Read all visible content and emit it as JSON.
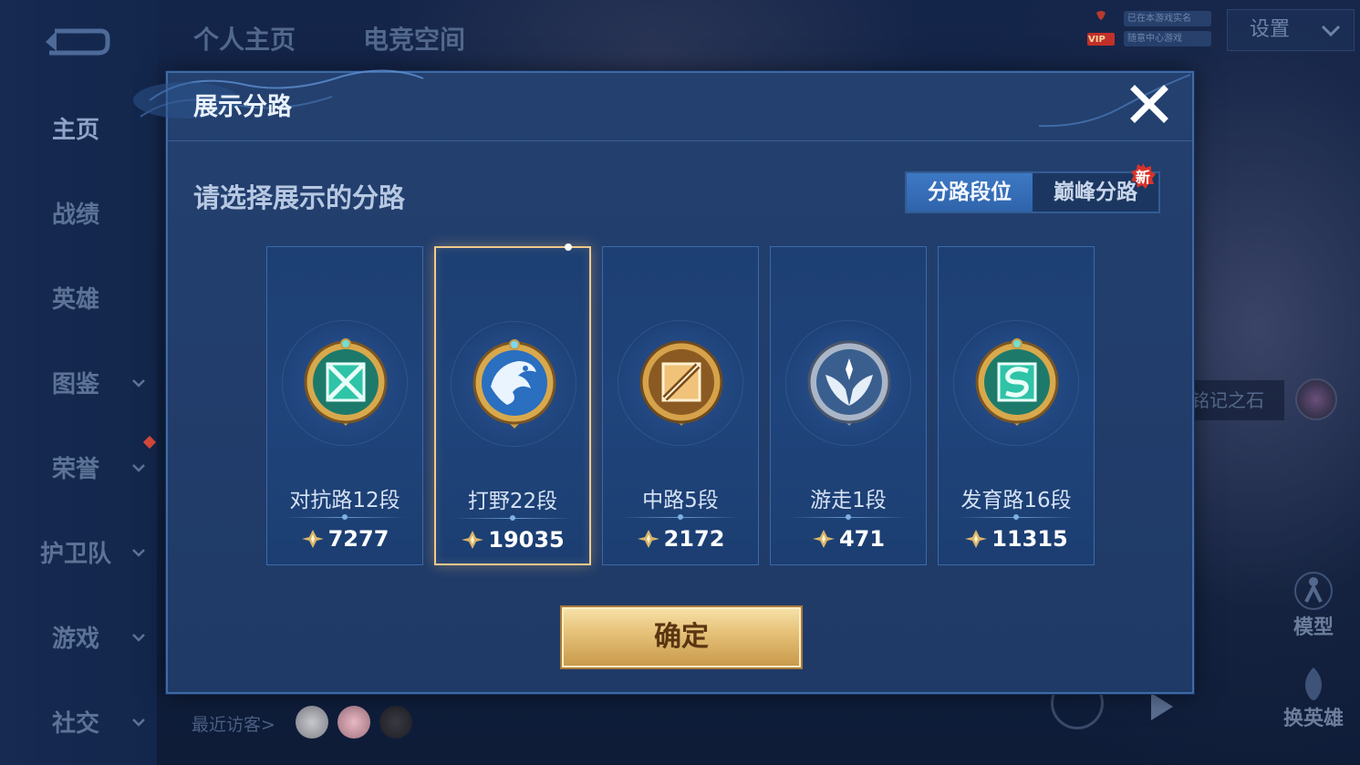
{
  "sidebar": {
    "back_icon": "back-arrow-icon",
    "items": [
      {
        "label": "主页",
        "active": true,
        "has_chevron": false
      },
      {
        "label": "战绩",
        "active": false,
        "has_chevron": false
      },
      {
        "label": "英雄",
        "active": false,
        "has_chevron": false
      },
      {
        "label": "图鉴",
        "active": false,
        "has_chevron": true
      },
      {
        "label": "荣誉",
        "active": false,
        "has_chevron": true
      },
      {
        "label": "护卫队",
        "active": false,
        "has_chevron": true
      },
      {
        "label": "游戏",
        "active": false,
        "has_chevron": true
      },
      {
        "label": "社交",
        "active": false,
        "has_chevron": true
      }
    ]
  },
  "header": {
    "tabs": [
      "个人主页",
      "电竞空间"
    ],
    "vip_badge": "VIP",
    "vip_line1": "已在本游戏实名",
    "vip_line2": "随意中心游戏",
    "settings_label": "设置"
  },
  "background": {
    "stone_label": "铭记之石",
    "model_label": "模型",
    "change_hero_label": "换英雄",
    "recent_visitors_label": "最近访客>"
  },
  "modal": {
    "title": "展示分路",
    "prompt": "请选择展示的分路",
    "toggle": {
      "active_label": "分路段位",
      "inactive_label": "巅峰分路",
      "new_badge": "新"
    },
    "lanes": [
      {
        "name": "对抗路12段",
        "score": "7277",
        "emblem": "clash-lane-emblem-icon",
        "selected": false
      },
      {
        "name": "打野22段",
        "score": "19035",
        "emblem": "jungle-dragon-emblem-icon",
        "selected": true
      },
      {
        "name": "中路5段",
        "score": "2172",
        "emblem": "mid-lane-emblem-icon",
        "selected": false
      },
      {
        "name": "游走1段",
        "score": "471",
        "emblem": "roam-wings-emblem-icon",
        "selected": false
      },
      {
        "name": "发育路16段",
        "score": "11315",
        "emblem": "farm-lane-emblem-icon",
        "selected": false
      }
    ],
    "confirm_label": "确定"
  },
  "colors": {
    "selected_border": "#f0c98a",
    "confirm_gold": "#e6c27a",
    "toggle_active": "#3d78c4",
    "modal_bg": "#23406f"
  }
}
